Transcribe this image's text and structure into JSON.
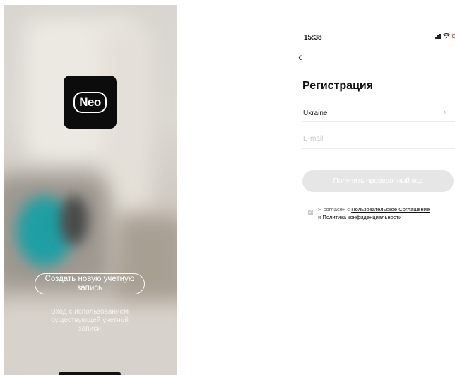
{
  "welcome": {
    "logo_text": "Neo",
    "create_account_label": "Создать новую учетную запись",
    "login_existing_label": "Вход с использованием существующей учетной записи"
  },
  "registration": {
    "status_time": "15:38",
    "title": "Регистрация",
    "country_value": "Ukraine",
    "email_placeholder": "E-mail",
    "email_value": "",
    "get_code_label": "Получить проверочный код",
    "agree_prefix": "Я согласен с",
    "user_agreement_link": "Пользовательское Соглашение",
    "agree_joiner": "и",
    "privacy_link": "Политика конфиденциальности"
  },
  "icons": {
    "back": "chevron-left-icon",
    "country_arrow": "chevron-right-icon",
    "checkbox": "checkbox-icon",
    "signal": "cellular-signal-icon",
    "wifi": "wifi-icon",
    "battery": "battery-icon"
  },
  "colors": {
    "logo_bg": "#0c0c0c",
    "disabled_button": "#e6e6e6",
    "battery_low": "#e25b5b"
  }
}
